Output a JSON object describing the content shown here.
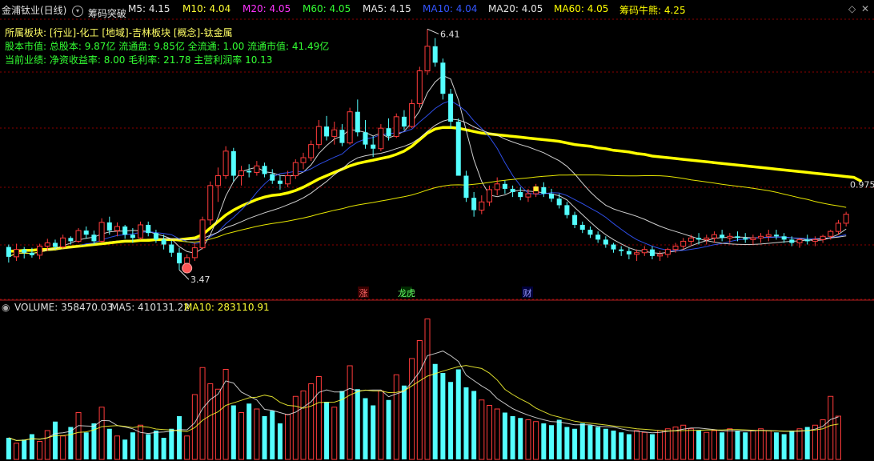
{
  "header": {
    "title": "金浦钛业(日线)",
    "indicator": "筹码突破",
    "ma_values": [
      {
        "label": "M5: 4.15",
        "color": "#e6e6e6"
      },
      {
        "label": "M10: 4.04",
        "color": "#ffff33"
      },
      {
        "label": "M20: 4.05",
        "color": "#ff33ff"
      },
      {
        "label": "M60: 4.05",
        "color": "#33ff33"
      },
      {
        "label": "MA5: 4.15",
        "color": "#e6e6e6"
      },
      {
        "label": "MA10: 4.04",
        "color": "#3355ff"
      },
      {
        "label": "MA20: 4.05",
        "color": "#e6e6e6"
      },
      {
        "label": "MA60: 4.05",
        "color": "#ffff00"
      },
      {
        "label": "筹码牛熊: 4.25",
        "color": "#ffff00"
      }
    ]
  },
  "info": {
    "line1": "所属板块: [行业]-化工 [地域]-吉林板块 [概念]-钛金属",
    "line2": "股本市值: 总股本: 9.87亿 流通盘: 9.85亿 全流通: 1.00 流通市值: 41.49亿",
    "line3": "当前业绩: 净资收益率: 8.00 毛利率: 21.78 主营利润率 10.13"
  },
  "markers": {
    "zhang": "涨",
    "longhu": "龙虎",
    "cai": "财"
  },
  "volume_header": {
    "vol": "VOLUME: 358470.03",
    "ma5": "MA5: 410131.22",
    "ma10": "MA10: 283110.91"
  },
  "colors": {
    "up": "#ff3b3b",
    "down": "#54ffff",
    "ma5": "#e6e6e6",
    "ma10": "#3355ff",
    "ma20": "#e6e6e6",
    "ma60": "#ffff00",
    "bull": "#ffff00",
    "grid": "#8b0000"
  },
  "chart_data": [
    {
      "type": "candlestick",
      "title": "金浦钛业(日线)",
      "yrange": [
        3.15,
        6.55
      ],
      "annotations": [
        {
          "text": "6.41",
          "kind": "high",
          "value": 6.41
        },
        {
          "text": "3.47",
          "kind": "low",
          "value": 3.47
        },
        {
          "text": "0.975",
          "kind": "right"
        }
      ],
      "ohlc": [
        [
          3.75,
          3.78,
          3.56,
          3.63
        ],
        [
          3.63,
          3.79,
          3.58,
          3.72
        ],
        [
          3.72,
          3.75,
          3.61,
          3.68
        ],
        [
          3.68,
          3.74,
          3.62,
          3.65
        ],
        [
          3.65,
          3.79,
          3.6,
          3.76
        ],
        [
          3.76,
          3.85,
          3.7,
          3.8
        ],
        [
          3.8,
          3.84,
          3.72,
          3.75
        ],
        [
          3.75,
          3.9,
          3.73,
          3.86
        ],
        [
          3.86,
          3.88,
          3.78,
          3.82
        ],
        [
          3.82,
          3.98,
          3.8,
          3.95
        ],
        [
          3.95,
          4.0,
          3.85,
          3.9
        ],
        [
          3.9,
          3.95,
          3.78,
          3.82
        ],
        [
          3.82,
          4.1,
          3.8,
          4.05
        ],
        [
          4.05,
          4.12,
          3.9,
          3.95
        ],
        [
          3.95,
          4.05,
          3.88,
          4.0
        ],
        [
          4.0,
          4.02,
          3.85,
          3.9
        ],
        [
          3.9,
          3.98,
          3.8,
          3.86
        ],
        [
          3.86,
          4.06,
          3.84,
          4.02
        ],
        [
          4.02,
          4.06,
          3.88,
          3.92
        ],
        [
          3.92,
          3.96,
          3.8,
          3.84
        ],
        [
          3.84,
          3.9,
          3.72,
          3.78
        ],
        [
          3.78,
          3.83,
          3.63,
          3.68
        ],
        [
          3.68,
          3.74,
          3.47,
          3.55
        ],
        [
          3.55,
          3.66,
          3.5,
          3.62
        ],
        [
          3.62,
          3.8,
          3.58,
          3.74
        ],
        [
          3.74,
          4.12,
          3.72,
          4.08
        ],
        [
          4.08,
          4.55,
          4.02,
          4.5
        ],
        [
          4.5,
          4.72,
          4.3,
          4.62
        ],
        [
          4.62,
          4.98,
          4.58,
          4.92
        ],
        [
          4.92,
          4.96,
          4.55,
          4.62
        ],
        [
          4.62,
          4.74,
          4.5,
          4.68
        ],
        [
          4.68,
          4.76,
          4.6,
          4.66
        ],
        [
          4.66,
          4.8,
          4.62,
          4.74
        ],
        [
          4.74,
          4.78,
          4.6,
          4.64
        ],
        [
          4.64,
          4.7,
          4.52,
          4.56
        ],
        [
          4.56,
          4.62,
          4.45,
          4.52
        ],
        [
          4.52,
          4.68,
          4.48,
          4.62
        ],
        [
          4.62,
          4.82,
          4.58,
          4.78
        ],
        [
          4.78,
          4.9,
          4.7,
          4.84
        ],
        [
          4.84,
          5.05,
          4.8,
          5.0
        ],
        [
          5.0,
          5.3,
          4.95,
          5.22
        ],
        [
          5.22,
          5.35,
          5.05,
          5.1
        ],
        [
          5.1,
          5.28,
          5.0,
          5.18
        ],
        [
          5.18,
          5.25,
          4.98,
          5.02
        ],
        [
          5.02,
          5.45,
          5.0,
          5.4
        ],
        [
          5.4,
          5.55,
          5.1,
          5.15
        ],
        [
          5.15,
          5.3,
          4.95,
          5.0
        ],
        [
          5.0,
          5.1,
          4.85,
          4.95
        ],
        [
          4.95,
          5.25,
          4.92,
          5.2
        ],
        [
          5.2,
          5.32,
          5.05,
          5.1
        ],
        [
          5.1,
          5.38,
          5.08,
          5.34
        ],
        [
          5.34,
          5.42,
          5.18,
          5.22
        ],
        [
          5.22,
          5.55,
          5.2,
          5.5
        ],
        [
          5.5,
          5.95,
          5.45,
          5.9
        ],
        [
          5.9,
          6.41,
          5.85,
          6.2
        ],
        [
          6.2,
          6.3,
          5.95,
          6.0
        ],
        [
          6.0,
          6.05,
          5.55,
          5.62
        ],
        [
          5.62,
          5.68,
          5.2,
          5.28
        ],
        [
          5.28,
          5.32,
          4.9,
          4.62
        ],
        [
          4.62,
          4.68,
          4.3,
          4.35
        ],
        [
          4.35,
          4.42,
          4.12,
          4.2
        ],
        [
          4.2,
          4.38,
          4.15,
          4.3
        ],
        [
          4.3,
          4.5,
          4.25,
          4.45
        ],
        [
          4.45,
          4.6,
          4.38,
          4.52
        ],
        [
          4.52,
          4.56,
          4.4,
          4.46
        ],
        [
          4.46,
          4.5,
          4.36,
          4.42
        ],
        [
          4.42,
          4.48,
          4.32,
          4.36
        ],
        [
          4.36,
          4.46,
          4.3,
          4.4
        ],
        [
          4.4,
          4.52,
          4.36,
          4.48
        ],
        [
          4.48,
          4.54,
          4.36,
          4.4
        ],
        [
          4.4,
          4.46,
          4.3,
          4.34
        ],
        [
          4.34,
          4.4,
          4.22,
          4.26
        ],
        [
          4.26,
          4.3,
          4.1,
          4.14
        ],
        [
          4.14,
          4.18,
          3.98,
          4.02
        ],
        [
          4.02,
          4.06,
          3.92,
          3.96
        ],
        [
          3.96,
          4.0,
          3.86,
          3.9
        ],
        [
          3.9,
          3.94,
          3.8,
          3.84
        ],
        [
          3.84,
          3.88,
          3.74,
          3.78
        ],
        [
          3.78,
          3.8,
          3.68,
          3.72
        ],
        [
          3.72,
          3.76,
          3.64,
          3.7
        ],
        [
          3.7,
          3.74,
          3.6,
          3.66
        ],
        [
          3.66,
          3.72,
          3.58,
          3.68
        ],
        [
          3.68,
          3.76,
          3.64,
          3.72
        ],
        [
          3.72,
          3.76,
          3.6,
          3.64
        ],
        [
          3.64,
          3.7,
          3.58,
          3.66
        ],
        [
          3.66,
          3.74,
          3.62,
          3.72
        ],
        [
          3.72,
          3.8,
          3.68,
          3.76
        ],
        [
          3.76,
          3.86,
          3.72,
          3.82
        ],
        [
          3.82,
          3.9,
          3.76,
          3.86
        ],
        [
          3.86,
          3.92,
          3.78,
          3.84
        ],
        [
          3.84,
          3.9,
          3.78,
          3.86
        ],
        [
          3.86,
          3.94,
          3.8,
          3.9
        ],
        [
          3.9,
          3.96,
          3.82,
          3.86
        ],
        [
          3.86,
          3.92,
          3.8,
          3.88
        ],
        [
          3.88,
          3.94,
          3.82,
          3.86
        ],
        [
          3.86,
          3.92,
          3.8,
          3.84
        ],
        [
          3.84,
          3.9,
          3.78,
          3.86
        ],
        [
          3.86,
          3.92,
          3.8,
          3.88
        ],
        [
          3.88,
          3.96,
          3.82,
          3.9
        ],
        [
          3.9,
          3.96,
          3.84,
          3.88
        ],
        [
          3.88,
          3.92,
          3.8,
          3.84
        ],
        [
          3.84,
          3.88,
          3.76,
          3.8
        ],
        [
          3.8,
          3.86,
          3.74,
          3.84
        ],
        [
          3.84,
          3.9,
          3.78,
          3.82
        ],
        [
          3.82,
          3.88,
          3.76,
          3.84
        ],
        [
          3.84,
          3.9,
          3.8,
          3.88
        ],
        [
          3.88,
          3.96,
          3.84,
          3.94
        ],
        [
          3.94,
          4.08,
          3.9,
          4.04
        ],
        [
          4.04,
          4.18,
          4.0,
          4.15
        ]
      ],
      "bull_line": [
        3.7,
        3.7,
        3.71,
        3.71,
        3.72,
        3.72,
        3.73,
        3.74,
        3.75,
        3.76,
        3.77,
        3.78,
        3.79,
        3.8,
        3.81,
        3.82,
        3.82,
        3.83,
        3.83,
        3.84,
        3.84,
        3.84,
        3.84,
        3.85,
        3.86,
        3.9,
        3.98,
        4.06,
        4.14,
        4.2,
        4.25,
        4.29,
        4.33,
        4.36,
        4.38,
        4.39,
        4.41,
        4.44,
        4.48,
        4.53,
        4.58,
        4.62,
        4.66,
        4.7,
        4.74,
        4.77,
        4.79,
        4.81,
        4.83,
        4.85,
        4.88,
        4.92,
        4.98,
        5.06,
        5.14,
        5.19,
        5.21,
        5.21,
        5.2,
        5.18,
        5.16,
        5.14,
        5.13,
        5.12,
        5.11,
        5.1,
        5.09,
        5.08,
        5.07,
        5.06,
        5.05,
        5.04,
        5.02,
        5.0,
        4.99,
        4.98,
        4.96,
        4.95,
        4.93,
        4.92,
        4.91,
        4.89,
        4.88,
        4.86,
        4.85,
        4.84,
        4.83,
        4.82,
        4.81,
        4.8,
        4.79,
        4.78,
        4.77,
        4.76,
        4.75,
        4.74,
        4.73,
        4.72,
        4.71,
        4.7,
        4.69,
        4.68,
        4.67,
        4.66,
        4.65,
        4.64,
        4.63,
        4.62,
        4.61,
        4.6,
        4.55
      ],
      "volume": [
        120,
        90,
        110,
        140,
        100,
        160,
        210,
        130,
        180,
        260,
        150,
        200,
        290,
        170,
        130,
        110,
        150,
        190,
        140,
        160,
        120,
        170,
        240,
        130,
        360,
        510,
        420,
        390,
        500,
        300,
        260,
        310,
        280,
        240,
        270,
        200,
        250,
        350,
        380,
        420,
        460,
        320,
        290,
        380,
        520,
        390,
        340,
        300,
        380,
        330,
        470,
        410,
        560,
        660,
        780,
        530,
        480,
        430,
        500,
        400,
        380,
        330,
        300,
        280,
        260,
        240,
        230,
        220,
        210,
        200,
        190,
        220,
        180,
        170,
        200,
        190,
        180,
        170,
        160,
        150,
        140,
        160,
        150,
        140,
        160,
        170,
        180,
        190,
        170,
        160,
        150,
        160,
        150,
        170,
        160,
        150,
        160,
        170,
        160,
        150,
        140,
        160,
        170,
        180,
        190,
        220,
        350,
        240
      ]
    }
  ]
}
